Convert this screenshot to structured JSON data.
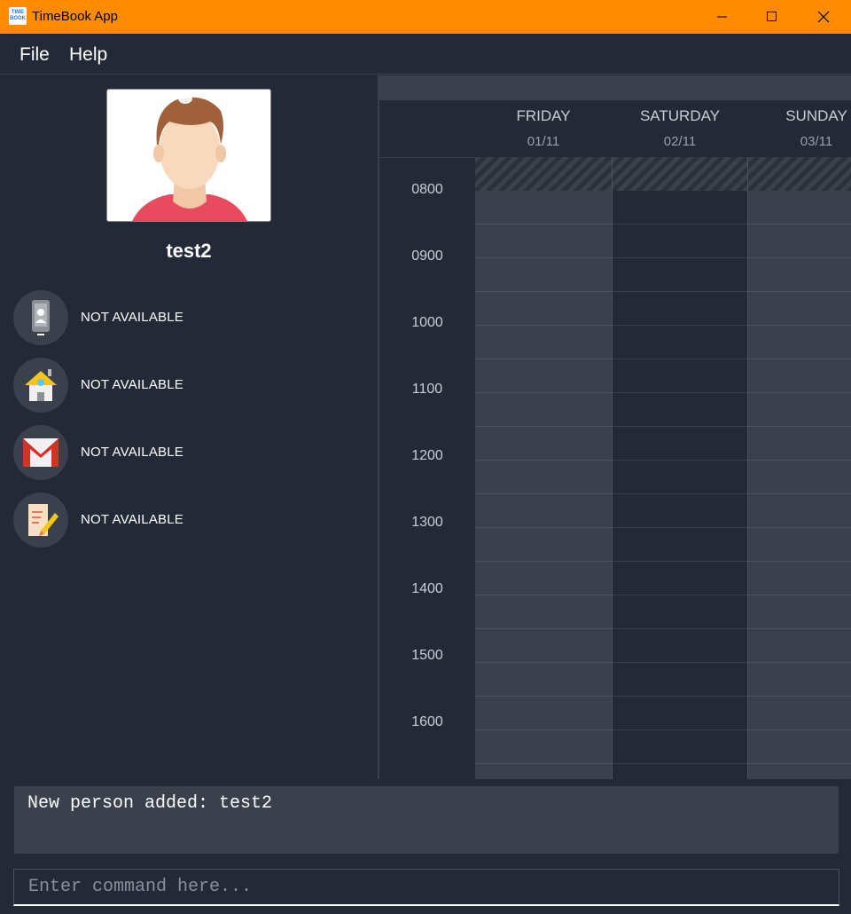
{
  "window": {
    "title": "TimeBook App",
    "icon_text": "TIME BOOK"
  },
  "menu": {
    "items": [
      "File",
      "Help"
    ]
  },
  "person": {
    "name": "test2",
    "details": [
      {
        "icon": "phone-icon",
        "value": "NOT AVAILABLE"
      },
      {
        "icon": "home-address-icon",
        "value": "NOT AVAILABLE"
      },
      {
        "icon": "gmail-icon",
        "value": "NOT AVAILABLE"
      },
      {
        "icon": "note-pencil-icon",
        "value": "NOT AVAILABLE"
      }
    ]
  },
  "calendar": {
    "days": [
      {
        "name": "FRIDAY",
        "date": "01/11"
      },
      {
        "name": "SATURDAY",
        "date": "02/11"
      },
      {
        "name": "SUNDAY",
        "date": "03/11"
      }
    ],
    "times": [
      "0800",
      "0900",
      "1000",
      "1100",
      "1200",
      "1300",
      "1400",
      "1500",
      "1600"
    ],
    "colors": {
      "weekday": "#3a404c",
      "weekend_dark": "#232937",
      "grid_line": "#4a505c"
    }
  },
  "result": {
    "text": "New person added: test2"
  },
  "command": {
    "placeholder": "Enter command here..."
  }
}
